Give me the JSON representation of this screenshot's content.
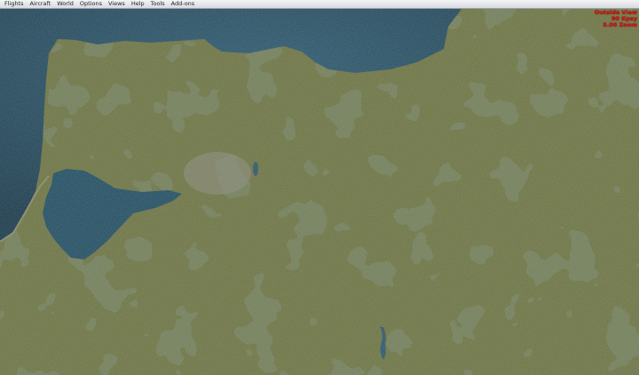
{
  "menu": {
    "items": [
      "Flights",
      "Aircraft",
      "World",
      "Options",
      "Views",
      "Help",
      "Tools",
      "Add-ons"
    ]
  },
  "status": {
    "view_mode": "Outside View",
    "heading": "90 Kpsy",
    "zoom": "5.00 Zoom"
  },
  "colors": {
    "water": "#1e4a66",
    "land": "#6e7444",
    "forest": "#2f3920",
    "status_text": "#dd1111"
  }
}
